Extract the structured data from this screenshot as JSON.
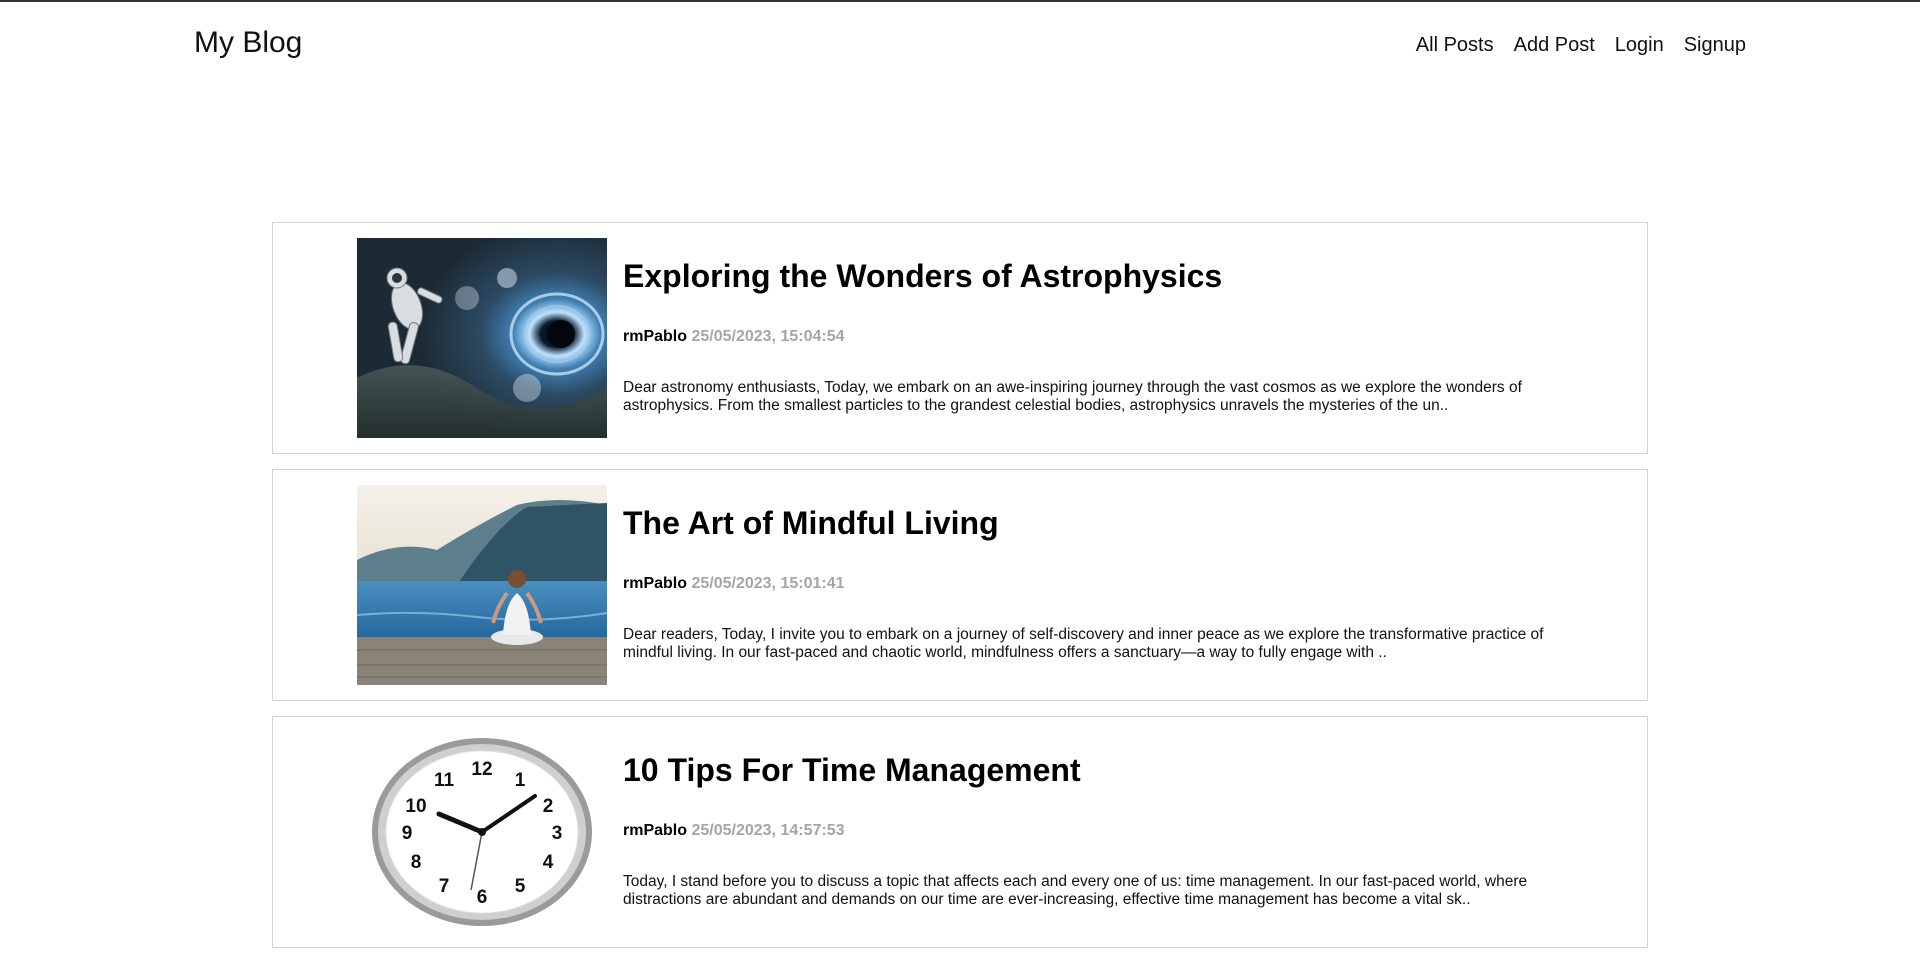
{
  "header": {
    "logo": "My Blog",
    "nav": [
      "All Posts",
      "Add Post",
      "Login",
      "Signup"
    ]
  },
  "posts": [
    {
      "title": "Exploring the Wonders of Astrophysics",
      "author": "rmPablo",
      "date": "25/05/2023, 15:04:54",
      "excerpt": "Dear astronomy enthusiasts, Today, we embark on an awe-inspiring journey through the vast cosmos as we explore the wonders of astrophysics. From the smallest particles to the grandest celestial bodies, astrophysics unravels the mysteries of the un..",
      "image_icon": "astronaut-space-image"
    },
    {
      "title": "The Art of Mindful Living",
      "author": "rmPablo",
      "date": "25/05/2023, 15:01:41",
      "excerpt": "Dear readers, Today, I invite you to embark on a journey of self-discovery and inner peace as we explore the transformative practice of mindful living. In our fast-paced and chaotic world, mindfulness offers a sanctuary—a way to fully engage with ..",
      "image_icon": "meditation-lake-image"
    },
    {
      "title": "10 Tips For Time Management",
      "author": "rmPablo",
      "date": "25/05/2023, 14:57:53",
      "excerpt": "Today, I stand before you to discuss a topic that affects each and every one of us: time management. In our fast-paced world, where distractions are abundant and demands on our time are ever-increasing, effective time management has become a vital sk..",
      "image_icon": "wall-clock-image"
    }
  ],
  "clock_numerals": [
    "12",
    "1",
    "2",
    "3",
    "4",
    "5",
    "6",
    "7",
    "8",
    "9",
    "10",
    "11"
  ]
}
